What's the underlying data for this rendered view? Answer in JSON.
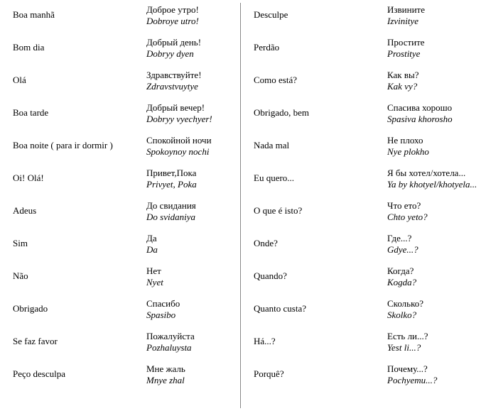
{
  "left": [
    {
      "term": "Boa manhã",
      "cyr": "Доброе утро!",
      "translit": "Dobroye utro!"
    },
    {
      "term": "Bom dia",
      "cyr": "Добрый день!",
      "translit": "Dobryy dyen"
    },
    {
      "term": "Olá",
      "cyr": "Здравствуйте!",
      "translit": "Zdravstvuytye"
    },
    {
      "term": "Boa tarde",
      "cyr": "Добрый вечер!",
      "translit": "Dobryy vyechyer!"
    },
    {
      "term": "Boa noite ( para ir dormir )",
      "cyr": "Спокойной ночи",
      "translit": "Spokoynoy nochi"
    },
    {
      "term": "Oi! Olá!",
      "cyr": "Привет,Пока",
      "translit": "Privyet, Poka"
    },
    {
      "term": "Adeus",
      "cyr": "До свидания",
      "translit": "Do svidaniya"
    },
    {
      "term": "Sim",
      "cyr": "Да",
      "translit": "Da"
    },
    {
      "term": "Não",
      "cyr": "Нет",
      "translit": "Nyet"
    },
    {
      "term": "Obrigado",
      "cyr": "Спасибо",
      "translit": "Spasibo"
    },
    {
      "term": "Se faz favor",
      "cyr": "Пожалуйста",
      "translit": "Pozhaluysta"
    },
    {
      "term": "Peço desculpa",
      "cyr": "Мне жаль",
      "translit": "Mnye zhal"
    }
  ],
  "right": [
    {
      "term": "Desculpe",
      "cyr": "Извините",
      "translit": "Izvinitye"
    },
    {
      "term": "Perdão",
      "cyr": "Простите",
      "translit": "Prostitye"
    },
    {
      "term": "Como está?",
      "cyr": "Как вы?",
      "translit": "Kak vy?"
    },
    {
      "term": "Obrigado, bem",
      "cyr": "Спасива хорошо",
      "translit": "Spasiva khorosho"
    },
    {
      "term": "Nada mal",
      "cyr": "Не плохо",
      "translit": "Nye plokho"
    },
    {
      "term": "Eu quero...",
      "cyr": "Я бы хотел/хотела...",
      "translit": "Ya by khotyel/khotyela..."
    },
    {
      "term": "O que é isto?",
      "cyr": "Что ето?",
      "translit": "Chto yeto?"
    },
    {
      "term": "Onde?",
      "cyr": "Где...?",
      "translit": "Gdye...?"
    },
    {
      "term": "Quando?",
      "cyr": "Когда?",
      "translit": "Kogda?"
    },
    {
      "term": "Quanto custa?",
      "cyr": "Сколько?",
      "translit": "Skolko?"
    },
    {
      "term": "Há...?",
      "cyr": "Есть ли...?",
      "translit": "Yest li...?"
    },
    {
      "term": "Porquê?",
      "cyr": "Почему...?",
      "translit": "Pochyemu...?"
    }
  ]
}
